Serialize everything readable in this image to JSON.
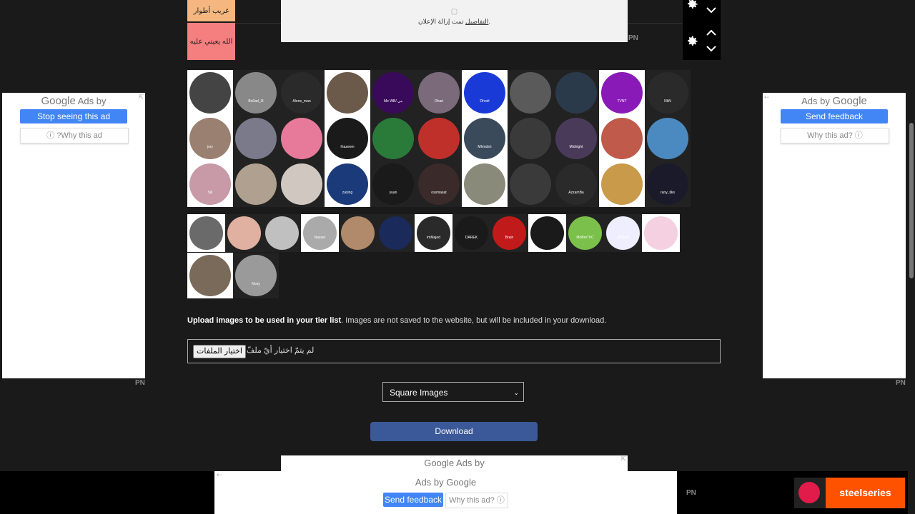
{
  "tiers": [
    {
      "label": "غريب أطوار",
      "color": "#f5b77f"
    },
    {
      "label": "الله يعيني عليه",
      "color": "#f57f7f"
    }
  ],
  "ad_removed_notice": {
    "text": "تمت إزالة الإعلان.",
    "details_link": "التفاصيل"
  },
  "pn_marks": {
    "top": "PN",
    "left": "PN",
    "right": "PN",
    "bottom": "PN"
  },
  "left_ad": {
    "brand": "Google",
    "header": "Ads by",
    "stop_button": "Stop seeing this ad",
    "why_button": "ⓘ ?Why this ad"
  },
  "right_ad": {
    "header": "Ads by",
    "brand": "Google",
    "feedback_button": "Send feedback",
    "why_button": "Why this ad? ⓘ"
  },
  "pool_tiles": [
    {
      "caption": "",
      "color": "#444"
    },
    {
      "caption": "Bo0ad_l3",
      "color": "#888"
    },
    {
      "caption": "Alone_man",
      "color": "#2a2a2a"
    },
    {
      "caption": "",
      "color": "#6b5a4a"
    },
    {
      "caption": "Me WB/ مي",
      "color": "#3a0a5a"
    },
    {
      "caption": "Dhari",
      "color": "#7a6a7a"
    },
    {
      "caption": "Dhroit",
      "color": "#1a3ad8"
    },
    {
      "caption": "",
      "color": "#5a5a5a"
    },
    {
      "caption": "",
      "color": "#2a3a4a"
    },
    {
      "caption": "TVNT",
      "color": "#8a1ab8"
    },
    {
      "caption": "NkN",
      "color": "#2a2a2a"
    },
    {
      "caption": "jory",
      "color": "#9a8070"
    },
    {
      "caption": "",
      "color": "#7a7a8a"
    },
    {
      "caption": "",
      "color": "#e77a9a"
    },
    {
      "caption": "Ihazeem",
      "color": "#1a1a1a"
    },
    {
      "caption": "",
      "color": "#2a7a3a"
    },
    {
      "caption": "",
      "color": "#c0302a"
    },
    {
      "caption": "Mhmdsh",
      "color": "#3a4a5a"
    },
    {
      "caption": "",
      "color": "#3a3a3a"
    },
    {
      "caption": "Midnight",
      "color": "#4a3a5a"
    },
    {
      "caption": "",
      "color": "#c05a4a"
    },
    {
      "caption": "",
      "color": "#4a8ac0"
    },
    {
      "caption": "Sill",
      "color": "#c89aa8"
    },
    {
      "caption": "",
      "color": "#b0a090"
    },
    {
      "caption": "",
      "color": "#d0c8c0"
    },
    {
      "caption": "zaxing",
      "color": "#1a3a7a"
    },
    {
      "caption": "yuan",
      "color": "#1a1a1a"
    },
    {
      "caption": "ossmasat",
      "color": "#3a2a2a"
    },
    {
      "caption": "",
      "color": "#8a8a7a"
    },
    {
      "caption": "",
      "color": "#3a3a3a"
    },
    {
      "caption": "AzzamBa",
      "color": "#2a2a2a"
    },
    {
      "caption": "",
      "color": "#c89a4a"
    },
    {
      "caption": "rany_tiks",
      "color": "#1a1a2a"
    },
    {
      "caption": "",
      "color": "#6a6a6a"
    },
    {
      "caption": "",
      "color": "#e0b0a0"
    },
    {
      "caption": "",
      "color": "#c0c0c0"
    },
    {
      "caption": "Nasser",
      "color": "#aaa"
    },
    {
      "caption": "",
      "color": "#b08a6a"
    },
    {
      "caption": "",
      "color": "#1a2a5a"
    },
    {
      "caption": "imMajed",
      "color": "#2a2a2a"
    },
    {
      "caption": "DAREK",
      "color": "#1a1a1a"
    },
    {
      "caption": "Brain",
      "color": "#c01a1a"
    },
    {
      "caption": "",
      "color": "#1a1a1a"
    },
    {
      "caption": "MoBreThC",
      "color": "#7ac04a"
    },
    {
      "caption": "JArSam",
      "color": "#eef"
    },
    {
      "caption": "",
      "color": "#f4d0e0"
    },
    {
      "caption": "",
      "color": "#7a6a5a"
    },
    {
      "caption": "Nosy",
      "color": "#9a9a9a"
    }
  ],
  "upload": {
    "bold": "Upload images to be used in your tier list",
    "rest": ". Images are not saved to the website, but will be included in your download.",
    "file_button": "اختيار الملفات",
    "file_status": "لم يتمّ اختيار أيّ ملفّ"
  },
  "select": {
    "value": "Square Images"
  },
  "download_label": "Download",
  "bottom_ad": {
    "mid_header": "Google Ads by",
    "header": "Ads by Google",
    "feedback_button": "Send feedback",
    "why_button": "Why this ad? ⓘ"
  },
  "steelseries": {
    "label": "steelseries"
  }
}
